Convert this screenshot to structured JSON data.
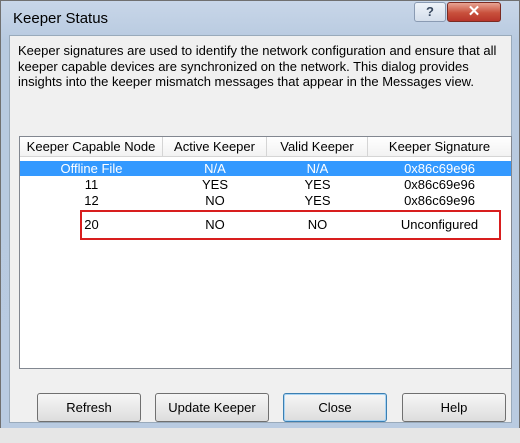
{
  "window": {
    "title": "Keeper Status",
    "help_glyph": "?",
    "close_glyph": "✕"
  },
  "description": "Keeper signatures are used to identify the network configuration and ensure that all keeper capable devices are synchronized on the network. This dialog provides insights into the keeper mismatch messages that appear in the Messages view.",
  "table": {
    "columns": [
      "Keeper Capable Node",
      "Active Keeper",
      "Valid Keeper",
      "Keeper Signature"
    ],
    "rows": [
      [
        "Offline File",
        "N/A",
        "N/A",
        "0x86c69e96"
      ],
      [
        "11",
        "YES",
        "YES",
        "0x86c69e96"
      ],
      [
        "12",
        "NO",
        "YES",
        "0x86c69e96"
      ],
      [
        "20",
        "NO",
        "NO",
        "Unconfigured"
      ]
    ],
    "selected_row": 0,
    "highlighted_row": 3,
    "colors": {
      "selection": "#3399ff",
      "highlight_box": "#d81e1e"
    }
  },
  "buttons": {
    "refresh": "Refresh",
    "update_keeper": "Update Keeper",
    "close": "Close",
    "help": "Help"
  }
}
